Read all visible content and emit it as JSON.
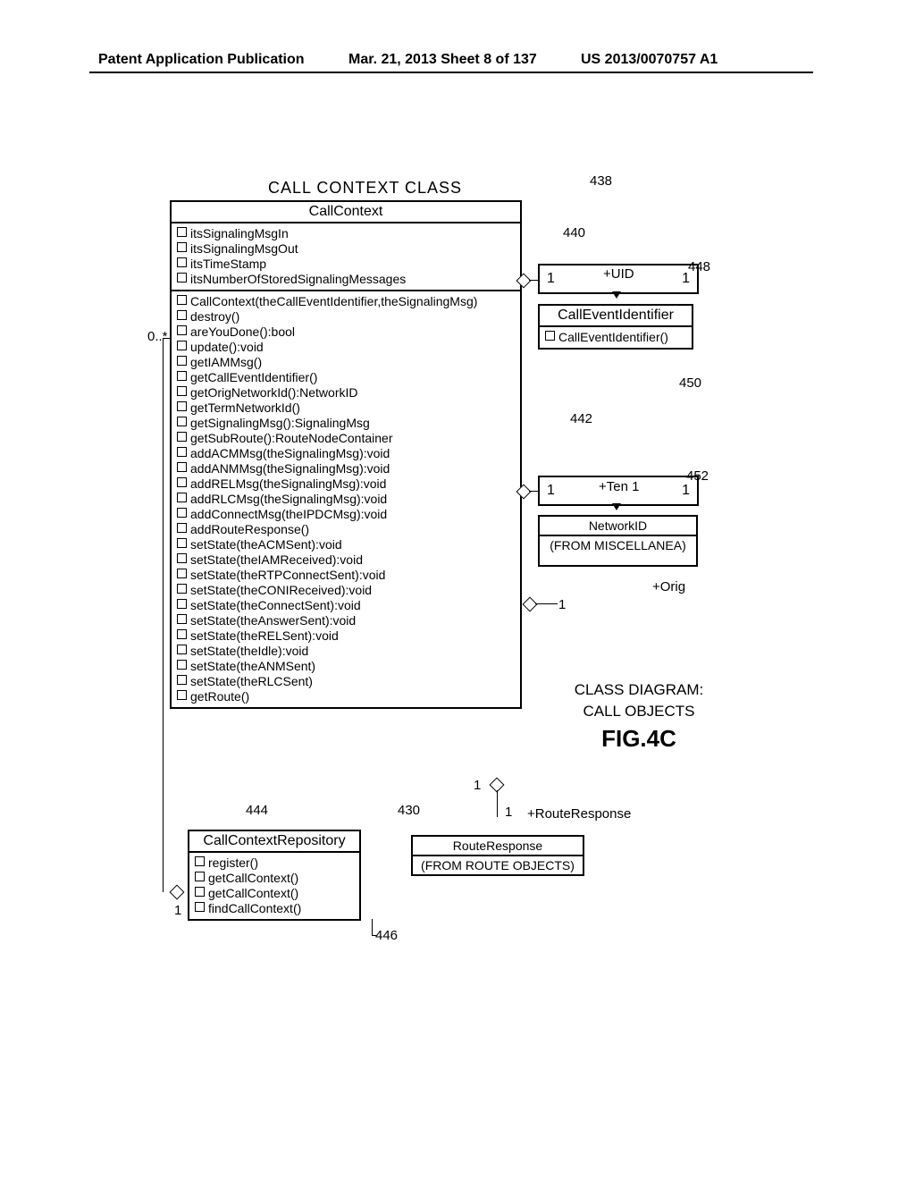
{
  "header": {
    "left": "Patent Application Publication",
    "mid": "Mar. 21, 2013  Sheet 8 of 137",
    "right": "US 2013/0070757 A1"
  },
  "titles": {
    "main": "CALL  CONTEXT  CLASS"
  },
  "callContext": {
    "name": "CallContext",
    "attrs": [
      "itsSignalingMsgIn",
      "itsSignalingMsgOut",
      "itsTimeStamp",
      "itsNumberOfStoredSignalingMessages"
    ],
    "ops": [
      "CallContext(theCallEventIdentifier,theSignalingMsg)",
      "destroy()",
      "areYouDone():bool",
      "update():void",
      "getIAMMsg()",
      "getCallEventIdentifier()",
      "getOrigNetworkId():NetworkID",
      "getTermNetworkId()",
      "getSignalingMsg():SignalingMsg",
      "getSubRoute():RouteNodeContainer",
      "addACMMsg(theSignalingMsg):void",
      "addANMMsg(theSignalingMsg):void",
      "addRELMsg(theSignalingMsg):void",
      "addRLCMsg(theSignalingMsg):void",
      "addConnectMsg(theIPDCMsg):void",
      "addRouteResponse()",
      "setState(theACMSent):void",
      "setState(theIAMReceived):void",
      "setState(theRTPConnectSent):void",
      "setState(theCONIReceived):void",
      "setState(theConnectSent):void",
      "setState(theAnswerSent):void",
      "setState(theRELSent):void",
      "setState(theIdle):void",
      "setState(theANMSent)",
      "setState(theRLCSent)",
      "getRoute()"
    ]
  },
  "callEventIdentifier": {
    "name": "CallEventIdentifier",
    "ops": [
      "CallEventIdentifier()"
    ],
    "role": "+UID",
    "mult1": "1",
    "mult2": "1"
  },
  "networkId": {
    "name": "NetworkID",
    "sub": "(FROM  MISCELLANEA)",
    "role1": "+Ten 1",
    "role2": "+Orig",
    "mult1": "1",
    "mult2": "1",
    "mult3": "1"
  },
  "routeResponse": {
    "name": "RouteResponse",
    "sub": "(FROM  ROUTE OBJECTS)",
    "role": "+RouteResponse",
    "mult1": "1",
    "mult2": "1"
  },
  "callContextRepository": {
    "name": "CallContextRepository",
    "ops": [
      "register()",
      "getCallContext()",
      "getCallContext()",
      "findCallContext()"
    ],
    "mult": "1",
    "leftMult": "0..*"
  },
  "refs": {
    "r438": "438",
    "r440": "440",
    "r448": "448",
    "r450": "450",
    "r442": "442",
    "r452": "452",
    "r444": "444",
    "r430": "430",
    "r446": "446"
  },
  "caption": {
    "l1": "CLASS  DIAGRAM:",
    "l2": "CALL  OBJECTS",
    "fig": "FIG.4C"
  }
}
